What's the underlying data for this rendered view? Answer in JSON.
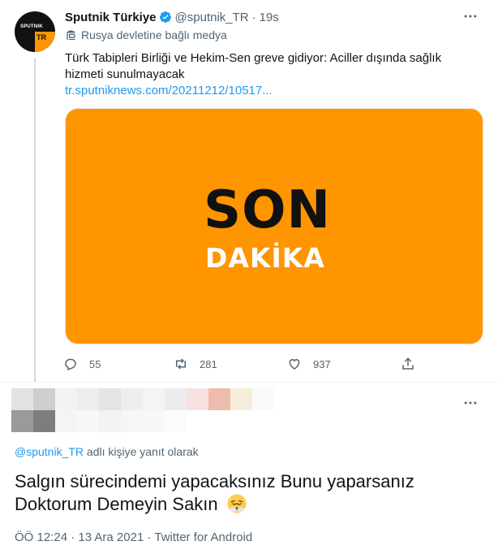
{
  "original_tweet": {
    "avatar_brand": "SPUTNIK",
    "avatar_tag": "TR",
    "display_name": "Sputnik Türkiye",
    "handle": "@sputnik_TR",
    "separator": "·",
    "time": "19s",
    "state_label": "Rusya devletine bağlı medya",
    "text": "Türk Tabipleri Birliği ve Hekim-Sen greve gidiyor: Aciller dışında sağlık hizmeti sunulmayacak",
    "link": "tr.sputniknews.com/20211212/10517...",
    "media": {
      "line1": "SON",
      "line2": "DAKİKA",
      "background": "#ff9500"
    },
    "actions": {
      "reply_count": "55",
      "retweet_count": "281",
      "like_count": "937"
    },
    "more_icon": "more-horizontal-icon"
  },
  "reply": {
    "replying_to_handle": "@sputnik_TR",
    "replying_to_suffix": " adlı kişiye yanıt olarak",
    "text": "Salgın sürecindemi yapacaksınız Bunu yaparsanız Doktorum Demeyin Sakın",
    "emoji": "face-with-steam-icon",
    "time": "ÖÖ 12:24",
    "dot1": " · ",
    "date": "13 Ara 2021",
    "dot2": " · ",
    "client": "Twitter for Android"
  },
  "colors": {
    "accent": "#1d9bf0",
    "secondary_text": "#536471",
    "primary_text": "#0f1419",
    "media_orange": "#ff9500"
  }
}
